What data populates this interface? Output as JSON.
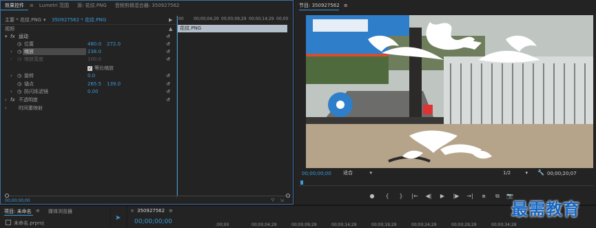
{
  "effect_controls": {
    "tabs": [
      "效果控件",
      "Lumetri 范围",
      "源: 花纹.PNG",
      "音频剪辑混合器: 350927562"
    ],
    "source_label": "主要 * 花纹.PNG",
    "sequence_label": "350927562 * 花纹.PNG",
    "video_heading": "视频",
    "motion_label": "运动",
    "position_label": "位置",
    "position_x": "480.0",
    "position_y": "272.0",
    "scale_label": "缩放",
    "scale_value": "238.0",
    "scale_width_label": "缩放宽度",
    "scale_width_value": "100.0",
    "uniform_scale_label": "等比缩放",
    "rotation_label": "旋转",
    "rotation_value": "0.0",
    "anchor_label": "锚点",
    "anchor_x": "265.5",
    "anchor_y": "139.0",
    "antiflicker_label": "防闪烁滤镜",
    "antiflicker_value": "0.00",
    "opacity_label": "不透明度",
    "time_remap_label": "时间重映射",
    "fx_label": "fx",
    "timecode_bottom": "00;00;00;00"
  },
  "mini_timeline": {
    "ruler": [
      "00",
      "00;00;04;29",
      "00;00;09;29",
      "00;00;14;29",
      "00;00"
    ],
    "clip_label": "花纹.PNG"
  },
  "program": {
    "title": "节目: 350927562",
    "timecode": "00;00;00;00",
    "fit_label": "适合",
    "resolution": "1/2",
    "duration": "00;00;20;07"
  },
  "project": {
    "tabs": [
      "项目: 未命名",
      "媒体浏览器"
    ],
    "file": "未命名.prproj"
  },
  "timeline": {
    "sequence_tab": "350927562",
    "timecode": "00;00;00;00",
    "ruler": [
      ";00;00",
      "00;00;04;29",
      "00;00;09;29",
      "00;00;14;29",
      "00;00;19;29",
      "00;00;24;29",
      "00;00;29;29",
      "00;00;34;28"
    ]
  },
  "watermark": "最需教育",
  "colors": {
    "accent": "#3b9bd9",
    "panel": "#232323",
    "clip": "#b3bfca"
  }
}
